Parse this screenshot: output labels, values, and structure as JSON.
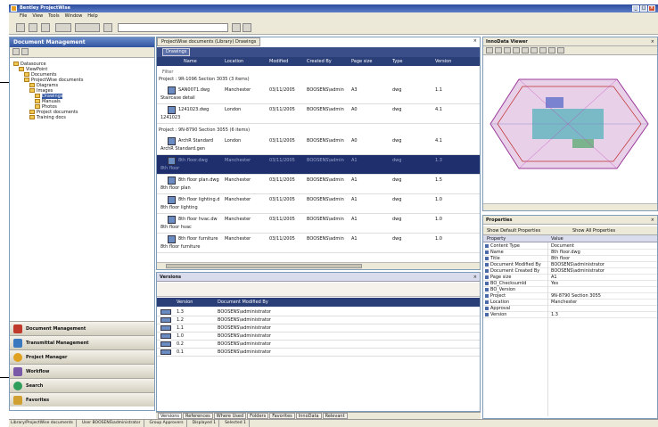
{
  "window": {
    "title": "Bentley ProjectWise"
  },
  "menubar": [
    "File",
    "View",
    "Tools",
    "Window",
    "Help"
  ],
  "toolbar": {
    "search_placeholder": ""
  },
  "left_panel": {
    "title": "Document Management",
    "tree": [
      {
        "label": "Datasource",
        "level": 0
      },
      {
        "label": "ViewPoint",
        "level": 1
      },
      {
        "label": "Documents",
        "level": 2
      },
      {
        "label": "ProjectWise documents",
        "level": 2
      },
      {
        "label": "Diagrams",
        "level": 3
      },
      {
        "label": "Images",
        "level": 3
      },
      {
        "label": "Drawings",
        "level": 4,
        "selected": true
      },
      {
        "label": "Manuals",
        "level": 4
      },
      {
        "label": "Photos",
        "level": 4
      },
      {
        "label": "Project documents",
        "level": 3
      },
      {
        "label": "Training docs",
        "level": 3
      }
    ],
    "nav": [
      {
        "label": "Document Management",
        "color": "#c0392b"
      },
      {
        "label": "Transmittal Management",
        "color": "#3a78c0"
      },
      {
        "label": "Project Manager",
        "color": "#e0a020"
      },
      {
        "label": "Workflow",
        "color": "#7a5aa8"
      },
      {
        "label": "Search",
        "color": "#2e9e5a"
      },
      {
        "label": "Favorites",
        "color": "#d0a030"
      }
    ]
  },
  "center": {
    "tab": "ProjectWise documents (Library) Drawings",
    "subtab": "Drawings",
    "columns": [
      "Name",
      "Location",
      "Modified",
      "Created By",
      "Page size",
      "Type",
      "Version"
    ],
    "filter_row": "Filter",
    "groups": [
      {
        "label": "Project : 9R-1096 Section 3035 (3 items)",
        "rows": [
          {
            "name": "SAN0071.dwg",
            "sub": "Staircase detail",
            "location": "Manchester",
            "modified": "03/11/2005",
            "created": "BOOSENS\\admin",
            "size": "A3",
            "type": "dwg",
            "version": "1.1"
          },
          {
            "name": "1241023.dwg",
            "sub": "1241023",
            "location": "London",
            "modified": "03/11/2005",
            "created": "BOOSENS\\admin",
            "size": "A0",
            "type": "dwg",
            "version": "4.1"
          }
        ]
      },
      {
        "label": "Project : 9N-8790 Section 3055 (6 items)",
        "rows": [
          {
            "name": "ArchR Standard",
            "sub": "ArchR Standard.gen",
            "location": "London",
            "modified": "03/11/2005",
            "created": "BOOSENS\\admin",
            "size": "A0",
            "type": "dwg",
            "version": "4.1"
          },
          {
            "name": "8th floor.dwg",
            "sub": "8th floor",
            "location": "Manchester",
            "modified": "03/11/2005",
            "created": "BOOSENS\\admin",
            "size": "A1",
            "type": "dwg",
            "version": "1.3",
            "selected": true
          },
          {
            "name": "8th floor plan.dwg",
            "sub": "8th floor plan",
            "location": "Manchester",
            "modified": "03/11/2005",
            "created": "BOOSENS\\admin",
            "size": "A1",
            "type": "dwg",
            "version": "1.5"
          },
          {
            "name": "8th floor lighting.d",
            "sub": "8th floor lighting",
            "location": "Manchester",
            "modified": "03/11/2005",
            "created": "BOOSENS\\admin",
            "size": "A1",
            "type": "dwg",
            "version": "1.0"
          },
          {
            "name": "8th floor hvac.dw",
            "sub": "8th floor hvac",
            "location": "Manchester",
            "modified": "03/11/2005",
            "created": "BOOSENS\\admin",
            "size": "A1",
            "type": "dwg",
            "version": "1.0"
          },
          {
            "name": "8th floor furniture",
            "sub": "8th floor furniture",
            "location": "Manchester",
            "modified": "03/11/2005",
            "created": "BOOSENS\\admin",
            "size": "A1",
            "type": "dwg",
            "version": "1.0"
          }
        ]
      }
    ]
  },
  "versions": {
    "title": "Versions",
    "columns": [
      "Version",
      "Document Modified By"
    ],
    "rows": [
      {
        "version": "1.3",
        "by": "BOOSENS\\administrator"
      },
      {
        "version": "1.2",
        "by": "BOOSENS\\administrator"
      },
      {
        "version": "1.1",
        "by": "BOOSENS\\administrator"
      },
      {
        "version": "1.0",
        "by": "BOOSENS\\administrator"
      },
      {
        "version": "0.2",
        "by": "BOOSENS\\administrator"
      },
      {
        "version": "0.1",
        "by": "BOOSENS\\administrator"
      }
    ]
  },
  "bottom_tabs": [
    "Versions",
    "References",
    "Where Used",
    "Folders",
    "Favorites",
    "InnoData",
    "Relevant"
  ],
  "viewer": {
    "title": "InnoData Viewer"
  },
  "properties": {
    "title": "Properties",
    "tab_default": "Show Default Properties",
    "tab_all": "Show All Properties",
    "columns": [
      "Property",
      "Value"
    ],
    "rows": [
      {
        "p": "Content Type",
        "v": "Document"
      },
      {
        "p": "Name",
        "v": "8th floor.dwg"
      },
      {
        "p": "Title",
        "v": "8th floor"
      },
      {
        "p": "Document Modified By",
        "v": "BOOSENS\\administrator"
      },
      {
        "p": "Document Created By",
        "v": "BOOSENS\\administrator"
      },
      {
        "p": "Page size",
        "v": "A1"
      },
      {
        "p": "BO_ChecksumId",
        "v": "Yes"
      },
      {
        "p": "BO_Version",
        "v": ""
      },
      {
        "p": "Project",
        "v": "9N-8790 Section 3055"
      },
      {
        "p": "Location",
        "v": "Manchester"
      },
      {
        "p": "Approval",
        "v": ""
      },
      {
        "p": "Version",
        "v": "1.3"
      }
    ]
  },
  "statusbar": [
    "Library/ProjectWise documents",
    "User BOOSENS\\administrator",
    "Group Approvers",
    "Displayed 1",
    "Selected 1"
  ]
}
